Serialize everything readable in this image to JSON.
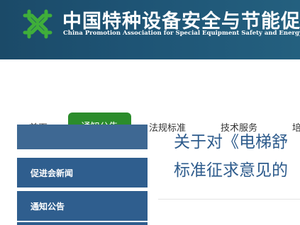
{
  "header": {
    "title_cn": "中国特种设备安全与节能促进",
    "title_en": "China Promotion Association for Special Equipment Safety and Energy"
  },
  "nav": {
    "home": "首页",
    "active": "通知公告",
    "laws": "法规标准",
    "tech": "技术服务",
    "training": "培"
  },
  "sidebar": {
    "items": [
      {
        "label": "促进会新闻"
      },
      {
        "label": "通知公告"
      }
    ]
  },
  "article": {
    "title_line1": "关于对《电梯舒",
    "title_line2": "标准征求意见的"
  },
  "colors": {
    "header_bg": "#1e5475",
    "nav_active_bg": "#2b8c2b",
    "sidebar_bg": "#2f5e8e",
    "title_color": "#2d5b8c"
  },
  "icons": {
    "logo": "association-logo-icon"
  }
}
